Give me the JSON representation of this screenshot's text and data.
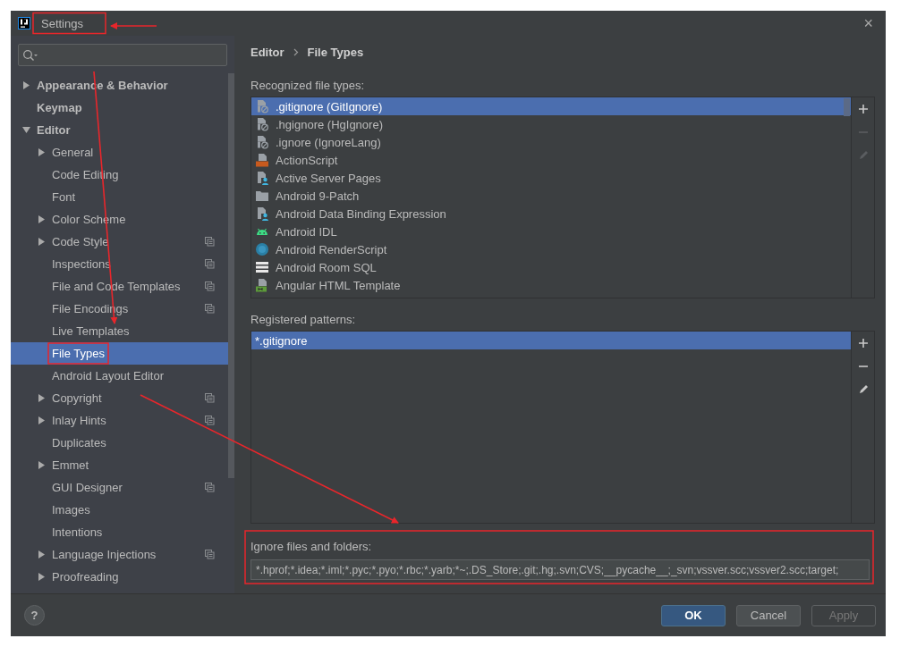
{
  "window": {
    "title": "Settings",
    "annotated": true,
    "close": "×"
  },
  "sidebar": {
    "items": [
      {
        "label": "Appearance & Behavior",
        "kind": "group",
        "expanded": false,
        "selected": false,
        "project_scoped": false,
        "annotated": false
      },
      {
        "label": "Keymap",
        "kind": "page",
        "selected": false,
        "project_scoped": false,
        "annotated": false
      },
      {
        "label": "Editor",
        "kind": "group",
        "expanded": true,
        "selected": false,
        "project_scoped": false,
        "annotated": false,
        "children": [
          {
            "label": "General",
            "kind": "group",
            "expanded": false,
            "selected": false,
            "project_scoped": false,
            "annotated": false
          },
          {
            "label": "Code Editing",
            "kind": "page",
            "selected": false,
            "project_scoped": false,
            "annotated": false
          },
          {
            "label": "Font",
            "kind": "page",
            "selected": false,
            "project_scoped": false,
            "annotated": false
          },
          {
            "label": "Color Scheme",
            "kind": "group",
            "expanded": false,
            "selected": false,
            "project_scoped": false,
            "annotated": false
          },
          {
            "label": "Code Style",
            "kind": "group",
            "expanded": false,
            "selected": false,
            "project_scoped": true,
            "annotated": false
          },
          {
            "label": "Inspections",
            "kind": "page",
            "selected": false,
            "project_scoped": true,
            "annotated": false
          },
          {
            "label": "File and Code Templates",
            "kind": "page",
            "selected": false,
            "project_scoped": true,
            "annotated": false
          },
          {
            "label": "File Encodings",
            "kind": "page",
            "selected": false,
            "project_scoped": true,
            "annotated": false
          },
          {
            "label": "Live Templates",
            "kind": "page",
            "selected": false,
            "project_scoped": false,
            "annotated": false
          },
          {
            "label": "File Types",
            "kind": "page",
            "selected": true,
            "project_scoped": false,
            "annotated": true
          },
          {
            "label": "Android Layout Editor",
            "kind": "page",
            "selected": false,
            "project_scoped": false,
            "annotated": false
          },
          {
            "label": "Copyright",
            "kind": "group",
            "expanded": false,
            "selected": false,
            "project_scoped": true,
            "annotated": false
          },
          {
            "label": "Inlay Hints",
            "kind": "group",
            "expanded": false,
            "selected": false,
            "project_scoped": true,
            "annotated": false
          },
          {
            "label": "Duplicates",
            "kind": "page",
            "selected": false,
            "project_scoped": false,
            "annotated": false
          },
          {
            "label": "Emmet",
            "kind": "group",
            "expanded": false,
            "selected": false,
            "project_scoped": false,
            "annotated": false
          },
          {
            "label": "GUI Designer",
            "kind": "page",
            "selected": false,
            "project_scoped": true,
            "annotated": false
          },
          {
            "label": "Images",
            "kind": "page",
            "selected": false,
            "project_scoped": false,
            "annotated": false
          },
          {
            "label": "Intentions",
            "kind": "page",
            "selected": false,
            "project_scoped": false,
            "annotated": false
          },
          {
            "label": "Language Injections",
            "kind": "group",
            "expanded": false,
            "selected": false,
            "project_scoped": true,
            "annotated": false
          },
          {
            "label": "Proofreading",
            "kind": "group",
            "expanded": false,
            "selected": false,
            "project_scoped": false,
            "annotated": false
          }
        ]
      }
    ]
  },
  "breadcrumb": [
    "Editor",
    "File Types"
  ],
  "recognized": {
    "label": "Recognized file types:",
    "items": [
      {
        "name": ".gitignore (GitIgnore)",
        "kind": "ignore",
        "selected": true
      },
      {
        "name": ".hgignore (HgIgnore)",
        "kind": "ignore",
        "selected": false
      },
      {
        "name": ".ignore (IgnoreLang)",
        "kind": "ignore",
        "selected": false
      },
      {
        "name": "ActionScript",
        "kind": "actionscript",
        "selected": false
      },
      {
        "name": "Active Server Pages",
        "kind": "server",
        "selected": false
      },
      {
        "name": "Android 9-Patch",
        "kind": "folder",
        "selected": false
      },
      {
        "name": "Android Data Binding Expression",
        "kind": "server",
        "selected": false
      },
      {
        "name": "Android IDL",
        "kind": "android",
        "selected": false
      },
      {
        "name": "Android RenderScript",
        "kind": "renderscript",
        "selected": false
      },
      {
        "name": "Android Room SQL",
        "kind": "table",
        "selected": false
      },
      {
        "name": "Angular HTML Template",
        "kind": "html",
        "selected": false
      }
    ],
    "tools": [
      {
        "kind": "add",
        "disabled": false
      },
      {
        "kind": "remove",
        "disabled": true
      },
      {
        "kind": "edit",
        "disabled": true
      }
    ]
  },
  "patterns": {
    "label": "Registered patterns:",
    "items": [
      {
        "name": "*.gitignore",
        "selected": true
      }
    ],
    "tools": [
      {
        "kind": "add",
        "disabled": false
      },
      {
        "kind": "remove",
        "disabled": false
      },
      {
        "kind": "edit",
        "disabled": false
      }
    ]
  },
  "ignore": {
    "label": "Ignore files and folders:",
    "value": "*.hprof;*.idea;*.iml;*.pyc;*.pyo;*.rbc;*.yarb;*~;.DS_Store;.git;.hg;.svn;CVS;__pycache__;_svn;vssver.scc;vssver2.scc;target;",
    "annotated": true
  },
  "footer": {
    "help": "?",
    "buttons": [
      {
        "label": "OK",
        "kind": "primary",
        "disabled": false
      },
      {
        "label": "Cancel",
        "kind": "normal",
        "disabled": false
      },
      {
        "label": "Apply",
        "kind": "normal",
        "disabled": true
      }
    ]
  }
}
